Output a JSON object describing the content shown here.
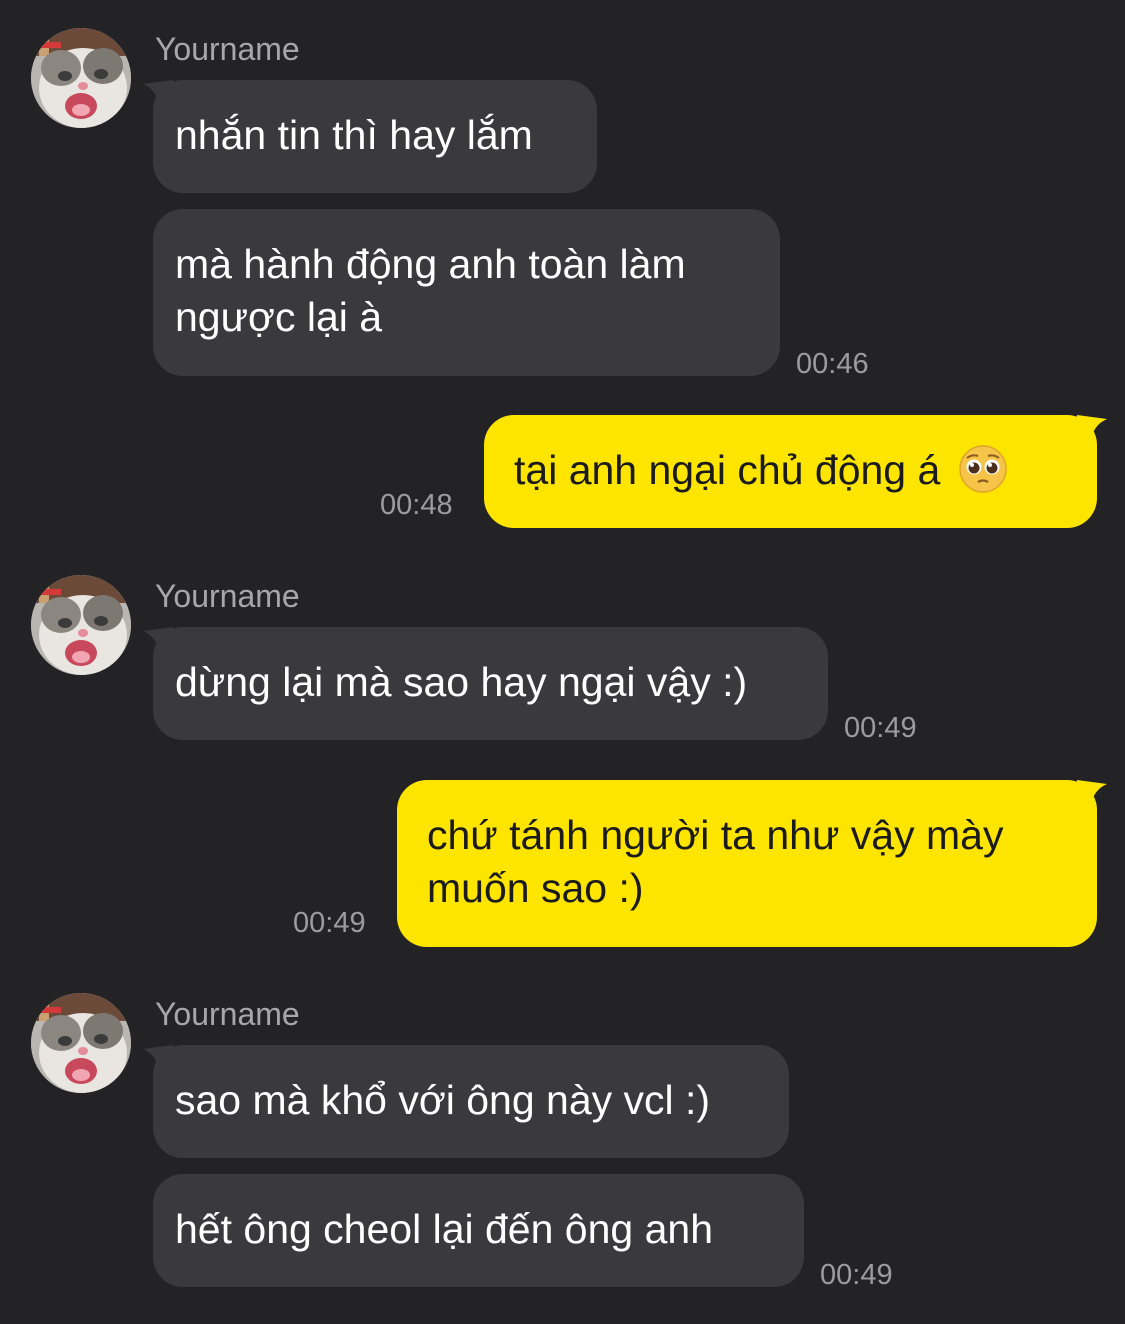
{
  "colors": {
    "background": "#232326",
    "incoming_bubble": "#3a3a3d",
    "outgoing_bubble": "#fde500",
    "timestamp": "#9b9ba0",
    "sender_name": "#a7a7ab"
  },
  "messages": [
    {
      "sender": "Yourname",
      "avatar": "cat-avatar-icon",
      "texts": [
        "nhắn tin thì hay lắm",
        "mà hành động anh toàn làm\nngược lại à"
      ],
      "time": "00:46"
    },
    {
      "text": "tại anh ngại chủ động á",
      "emoji": "pleading-face-icon",
      "time": "00:48"
    },
    {
      "sender": "Yourname",
      "avatar": "cat-avatar-icon",
      "texts": [
        "dừng lại mà sao hay ngại vậy :)"
      ],
      "time": "00:49"
    },
    {
      "text": "chứ tánh người ta như vậy mày\nmuốn sao :)",
      "time": "00:49"
    },
    {
      "sender": "Yourname",
      "avatar": "cat-avatar-icon",
      "texts": [
        "sao mà khổ với ông này vcl :)",
        "hết ông cheol lại đến ông anh"
      ],
      "time": "00:49"
    }
  ]
}
